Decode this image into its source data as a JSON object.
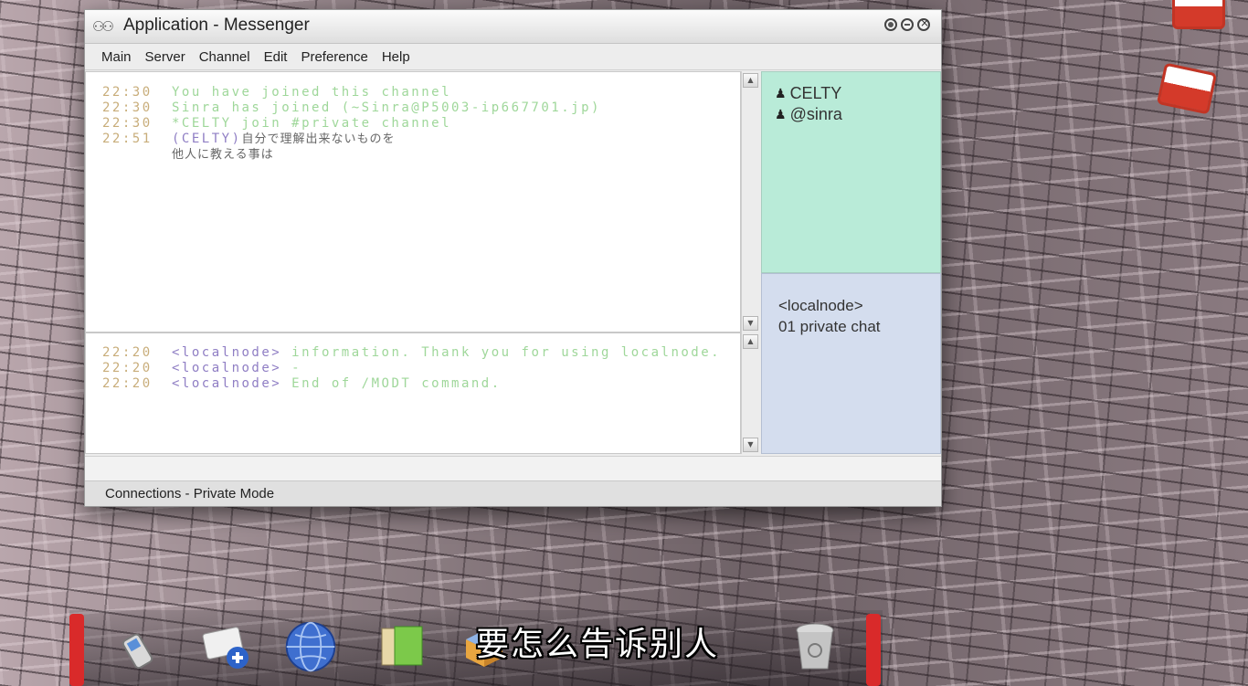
{
  "window": {
    "title": "Application - Messenger"
  },
  "menu": [
    "Main",
    "Server",
    "Channel",
    "Edit",
    "Preference",
    "Help"
  ],
  "chat": [
    {
      "time": "22:30",
      "text": "You have joined this channel",
      "style": "green"
    },
    {
      "time": "22:30",
      "text": "Sinra has joined (~Sinra@P5003-ip667701.jp)",
      "style": "green"
    },
    {
      "time": "22:30",
      "text": "*CELTY join #private channel",
      "style": "green"
    },
    {
      "time": "22:51",
      "nick": "(CELTY)",
      "text": "自分で理解出来ないものを",
      "style": "jp"
    },
    {
      "time": "",
      "text": "他人に教える事は",
      "style": "jp"
    }
  ],
  "server_log": [
    {
      "time": "22:20",
      "nick": "<localnode>",
      "text": "information. Thank you for using localnode."
    },
    {
      "time": "22:20",
      "nick": "<localnode>",
      "text": "-"
    },
    {
      "time": "22:20",
      "nick": "<localnode>",
      "text": "End of /MODT command."
    }
  ],
  "users": [
    "CELTY",
    "@sinra"
  ],
  "channels": {
    "server": "<localnode>",
    "channel": "01 private chat"
  },
  "status": "Connections - Private Mode",
  "subtitle": "要怎么告诉别人",
  "colors": {
    "users_bg": "#b9ebd8",
    "channels_bg": "#d4ddee",
    "timestamp": "#c8ad7a",
    "message_green": "#9fd79a",
    "nick_purple": "#8f7ec4"
  },
  "dock_icons": [
    "phone-icon",
    "mail-compose-icon",
    "globe-icon",
    "folder-icon",
    "box-icon",
    "trash-icon"
  ]
}
